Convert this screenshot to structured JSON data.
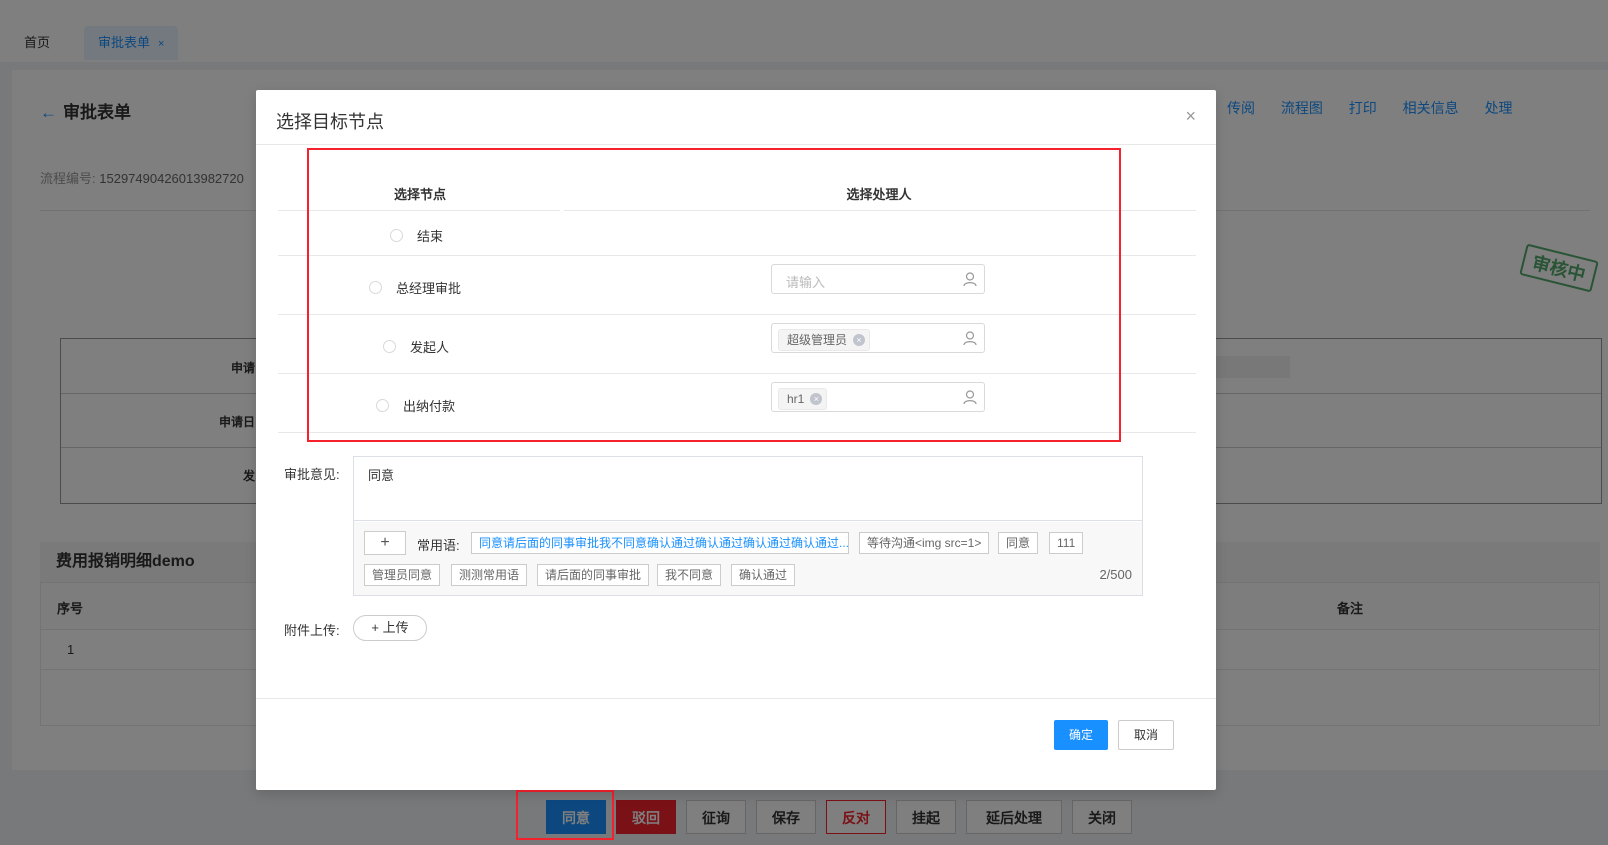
{
  "tabs": {
    "home": "首页",
    "active": "审批表单",
    "active_close": "×"
  },
  "page": {
    "back_title": "审批表单",
    "toolbar": [
      "传阅",
      "流程图",
      "打印",
      "相关信息",
      "处理"
    ],
    "flow_no_label": "流程编号:",
    "flow_no_value": "15297490426013982720",
    "stamp": "审核中",
    "form_labels": [
      "申请",
      "申请日",
      "发"
    ],
    "section_title": "费用报销明细demo",
    "table_headers": [
      "序号",
      "备注"
    ],
    "table_rows": [
      [
        "1"
      ]
    ]
  },
  "bottom_buttons": [
    "同意",
    "驳回",
    "征询",
    "保存",
    "反对",
    "挂起",
    "延后处理",
    "关闭"
  ],
  "modal": {
    "title": "选择目标节点",
    "close": "×",
    "col_node": "选择节点",
    "col_handler": "选择处理人",
    "rows": [
      {
        "node": "结束"
      },
      {
        "node": "总经理审批",
        "placeholder": "请输入"
      },
      {
        "node": "发起人",
        "tag": "超级管理员"
      },
      {
        "node": "出纳付款",
        "tag": "hr1"
      }
    ],
    "opinion_label": "审批意见:",
    "opinion_value": "同意",
    "plus": "+",
    "phrases_label": "常用语:",
    "phrases": [
      "同意请后面的同事审批我不同意确认通过确认通过确认通过确认通过...",
      "等待沟通<img src=1>",
      "同意",
      "111",
      "管理员同意",
      "测测常用语",
      "请后面的同事审批",
      "我不同意",
      "确认通过"
    ],
    "counter": "2/500",
    "attach_label": "附件上传:",
    "upload": "+ 上传",
    "ok": "确定",
    "cancel": "取消"
  },
  "colors": {
    "primary": "#1890ff",
    "danger": "#f5222d",
    "highlight_box": "#f5222d",
    "stamp": "#52a86b"
  },
  "icons": [
    "back-arrow-icon",
    "close-icon",
    "user-icon",
    "tag-remove-icon",
    "plus-icon"
  ]
}
